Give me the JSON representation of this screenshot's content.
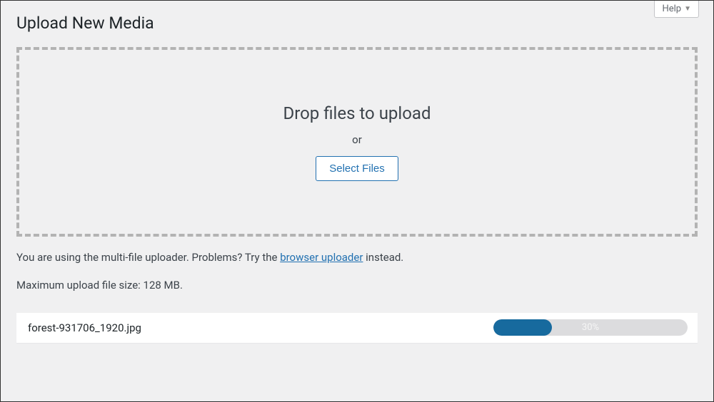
{
  "header": {
    "help_label": "Help"
  },
  "page": {
    "title": "Upload New Media"
  },
  "dropzone": {
    "title": "Drop files to upload",
    "or": "or",
    "select_files_label": "Select Files"
  },
  "info": {
    "prefix": "You are using the multi-file uploader. Problems? Try the ",
    "link_text": "browser uploader",
    "suffix": " instead."
  },
  "max_size_text": "Maximum upload file size: 128 MB.",
  "upload": {
    "filename": "forest-931706_1920.jpg",
    "progress_percent": 30,
    "progress_label": "30%"
  }
}
